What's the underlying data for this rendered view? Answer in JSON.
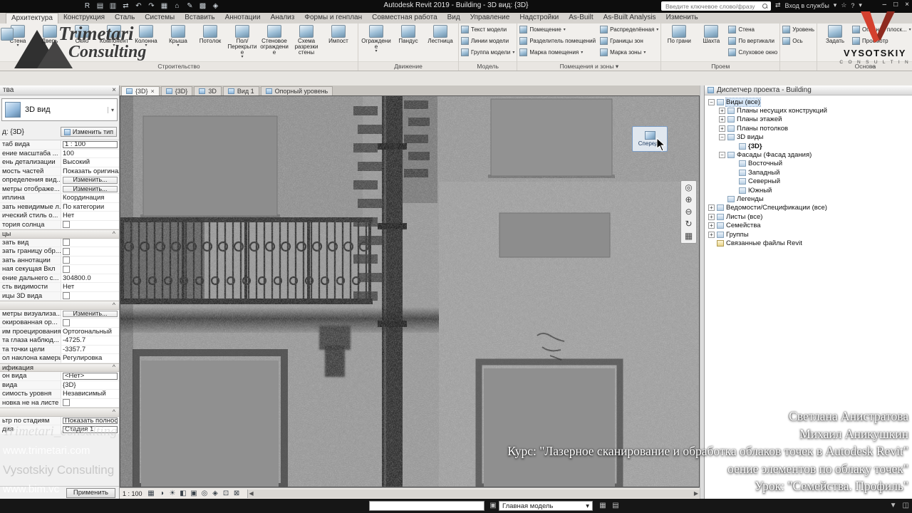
{
  "titlebar": {
    "title": "Autodesk Revit 2019 - Building - 3D вид: {3D}",
    "search_placeholder": "Введите ключевое слово/фразу",
    "qat_icons": [
      "R",
      "▤",
      "▥",
      "⇄",
      "↶",
      "↷",
      "▦",
      "⌂",
      "✎",
      "▩",
      "◈"
    ],
    "exchange_icon": "⇄",
    "signin_label": "Вход в службы",
    "signin_arrow": "▾",
    "star_icon": "☆",
    "help_icon": "?",
    "help_arrow": "▾",
    "window_buttons": [
      "–",
      "□",
      "×"
    ]
  },
  "ribbon": {
    "tabs": [
      {
        "label": "Архитектура",
        "cls": "active"
      },
      {
        "label": "Конструкция",
        "cls": ""
      },
      {
        "label": "Сталь",
        "cls": ""
      },
      {
        "label": "Системы",
        "cls": ""
      },
      {
        "label": "Вставить",
        "cls": ""
      },
      {
        "label": "Аннотации",
        "cls": ""
      },
      {
        "label": "Анализ",
        "cls": ""
      },
      {
        "label": "Формы и генплан",
        "cls": ""
      },
      {
        "label": "Совместная работа",
        "cls": ""
      },
      {
        "label": "Вид",
        "cls": ""
      },
      {
        "label": "Управление",
        "cls": ""
      },
      {
        "label": "Надстройки",
        "cls": ""
      },
      {
        "label": "As-Built",
        "cls": ""
      },
      {
        "label": "As-Built Analysis",
        "cls": ""
      },
      {
        "label": "Изменить",
        "cls": ""
      }
    ],
    "groups": [
      {
        "label": "Строительство",
        "big": [
          {
            "label": "Стена",
            "arrow": "▾"
          },
          {
            "label": "Дверь",
            "arrow": ""
          },
          {
            "label": "Окно",
            "arrow": ""
          },
          {
            "label": "Компонент",
            "arrow": "▾"
          },
          {
            "label": "Колонна",
            "arrow": "▾"
          },
          {
            "label": "Крыша",
            "arrow": "▾"
          },
          {
            "label": "Потолок",
            "arrow": ""
          },
          {
            "label": "Пол/Перекрытие",
            "arrow": "▾"
          },
          {
            "label": "Стеновое ограждение",
            "arrow": ""
          },
          {
            "label": "Схема разрезки стены",
            "arrow": ""
          },
          {
            "label": "Импост",
            "arrow": ""
          }
        ],
        "small": []
      },
      {
        "label": "Движение",
        "big": [
          {
            "label": "Ограждение",
            "arrow": "▾"
          },
          {
            "label": "Пандус",
            "arrow": ""
          },
          {
            "label": "Лестница",
            "arrow": ""
          }
        ],
        "small": []
      },
      {
        "label": "Модель",
        "big": [],
        "small": [
          {
            "label": "Текст модели",
            "arrow": ""
          },
          {
            "label": "Линии модели",
            "arrow": ""
          },
          {
            "label": "Группа модели",
            "arrow": "▾"
          }
        ]
      },
      {
        "label": "Помещения и зоны ▾",
        "big": [],
        "small": [
          {
            "label": "Помещение",
            "arrow": "▾"
          },
          {
            "label": "Распределённая",
            "arrow": "▾"
          },
          {
            "label": "Разделитель помещений",
            "arrow": ""
          },
          {
            "label": "Границы зон",
            "arrow": ""
          },
          {
            "label": "Марка помещения",
            "arrow": "▾"
          },
          {
            "label": "Марка зоны",
            "arrow": "▾"
          }
        ]
      },
      {
        "label": "Проем",
        "big": [
          {
            "label": "По грани",
            "arrow": ""
          },
          {
            "label": "Шахта",
            "arrow": ""
          }
        ],
        "small": [
          {
            "label": "Стена",
            "arrow": ""
          },
          {
            "label": "По вертикали",
            "arrow": ""
          },
          {
            "label": "Слуховое окно",
            "arrow": ""
          }
        ]
      },
      {
        "label": "",
        "big": [],
        "small": [
          {
            "label": "Уровень",
            "arrow": ""
          },
          {
            "label": "Ось",
            "arrow": ""
          }
        ]
      },
      {
        "label": "Основа",
        "big": [
          {
            "label": "Задать",
            "arrow": ""
          }
        ],
        "small": [
          {
            "label": "Опорная плоск...",
            "arrow": "▾"
          },
          {
            "label": "Просмотр",
            "arrow": ""
          }
        ]
      }
    ]
  },
  "properties": {
    "header": "тва",
    "close": "×",
    "selector_label": "3D вид",
    "selector_arrow": "▾",
    "type_label": "д: {3D}",
    "edit_type": "Изменить тип",
    "apply": "Применить",
    "rows": [
      {
        "label": "таб вида",
        "value": "1 : 100",
        "type": "box"
      },
      {
        "label": "ение масштаба ...",
        "value": "100",
        "type": "text"
      },
      {
        "label": "ень детализации",
        "value": "Высокий",
        "type": "text"
      },
      {
        "label": "мость частей",
        "value": "Показать оригинал",
        "type": "text"
      },
      {
        "label": "определения вид...",
        "value": "Изменить...",
        "type": "button"
      },
      {
        "label": "метры отображе...",
        "value": "Изменить...",
        "type": "button"
      },
      {
        "label": "иплина",
        "value": "Координация",
        "type": "text"
      },
      {
        "label": "зать невидимые л...",
        "value": "По категории",
        "type": "text"
      },
      {
        "label": "ический стиль о...",
        "value": "Нет",
        "type": "text"
      },
      {
        "label": "тория солнца",
        "value": "",
        "type": "checkbox"
      },
      {
        "label": "цы",
        "value": "",
        "type": "section"
      },
      {
        "label": "зать вид",
        "value": "",
        "type": "checkbox"
      },
      {
        "label": "зать границу обр...",
        "value": "",
        "type": "checkbox"
      },
      {
        "label": "зать аннотации",
        "value": "",
        "type": "checkbox"
      },
      {
        "label": "ная секущая Вкл",
        "value": "",
        "type": "checkbox"
      },
      {
        "label": "ение дальнего с...",
        "value": "304800.0",
        "type": "text"
      },
      {
        "label": "сть видимости",
        "value": "Нет",
        "type": "text"
      },
      {
        "label": "ицы 3D вида",
        "value": "",
        "type": "checkbox"
      },
      {
        "label": "",
        "value": "",
        "type": "section"
      },
      {
        "label": "метры визуализа...",
        "value": "Изменить...",
        "type": "button"
      },
      {
        "label": "окированная ор...",
        "value": "",
        "type": "checkbox"
      },
      {
        "label": "им проецирования",
        "value": "Ортогональный",
        "type": "text"
      },
      {
        "label": "та глаза наблюд...",
        "value": "-4725.7",
        "type": "text"
      },
      {
        "label": "та точки цели",
        "value": "-3357.7",
        "type": "text"
      },
      {
        "label": "ол наклона камеры",
        "value": "Регулировка",
        "type": "text"
      },
      {
        "label": "ификация",
        "value": "",
        "type": "section"
      },
      {
        "label": "он вида",
        "value": "<Нет>",
        "type": "box"
      },
      {
        "label": "вида",
        "value": "{3D}",
        "type": "text"
      },
      {
        "label": "симость уровня",
        "value": "Независимый",
        "type": "text"
      },
      {
        "label": "новка не на листе",
        "value": "",
        "type": "checkbox"
      },
      {
        "label": "",
        "value": "",
        "type": "section"
      },
      {
        "label": "ьтр по стадиям",
        "value": "Показать полност...",
        "type": "box"
      },
      {
        "label": "дия",
        "value": "Стадия 1",
        "type": "box"
      }
    ]
  },
  "view_tabs": [
    {
      "label": "{3D}",
      "cls": "active",
      "close": "×"
    },
    {
      "label": "{3D}",
      "cls": "",
      "close": ""
    },
    {
      "label": "3D",
      "cls": "",
      "close": ""
    },
    {
      "label": "Вид 1",
      "cls": "",
      "close": ""
    },
    {
      "label": "Опорный уровень",
      "cls": "",
      "close": ""
    }
  ],
  "viewport": {
    "viewcube_label": "Спереди",
    "nav_icons": [
      "◎",
      "⊕",
      "⊖",
      "↻",
      "▦"
    ],
    "controls": {
      "scale": "1 : 100",
      "icons": [
        "▦",
        "◑",
        "☀",
        "◧",
        "▣",
        "◎",
        "◈",
        "⊡",
        "⊠"
      ],
      "scroll_left": "◀",
      "scroll_right": "▶"
    }
  },
  "browser": {
    "title": "Диспетчер проекта - Building",
    "items": [
      {
        "glyph": "−",
        "label": "Виды (все)",
        "cls": "d0 sel"
      },
      {
        "glyph": "+",
        "label": "Планы несущих конструкций",
        "cls": "d1"
      },
      {
        "glyph": "+",
        "label": "Планы этажей",
        "cls": "d1"
      },
      {
        "glyph": "+",
        "label": "Планы потолков",
        "cls": "d1"
      },
      {
        "glyph": "−",
        "label": "3D виды",
        "cls": "d1"
      },
      {
        "glyph": "",
        "label": "{3D}",
        "cls": "d2 cur"
      },
      {
        "glyph": "−",
        "label": "Фасады (Фасад здания)",
        "cls": "d1"
      },
      {
        "glyph": "",
        "label": "Восточный",
        "cls": "d2"
      },
      {
        "glyph": "",
        "label": "Западный",
        "cls": "d2"
      },
      {
        "glyph": "",
        "label": "Северный",
        "cls": "d2"
      },
      {
        "glyph": "",
        "label": "Южный",
        "cls": "d2"
      },
      {
        "glyph": "",
        "label": "Легенды",
        "cls": "d1"
      },
      {
        "glyph": "+",
        "label": "Ведомости/Спецификации (все)",
        "cls": "d0"
      },
      {
        "glyph": "+",
        "label": "Листы (все)",
        "cls": "d0"
      },
      {
        "glyph": "+",
        "label": "Семейства",
        "cls": "d0"
      },
      {
        "glyph": "+",
        "label": "Группы",
        "cls": "d0"
      },
      {
        "glyph": "",
        "label": "Связанные файлы Revit",
        "cls": "d0 link"
      }
    ]
  },
  "statusbar": {
    "design_option": "Главная модель",
    "dropdown_arrow": "▾",
    "mid_icon": "▣",
    "icons": [
      "▦",
      "▤"
    ],
    "right_icons": [
      "▼",
      "◫"
    ]
  },
  "watermarks": {
    "left": [
      {
        "text": "Trimetari_consulting",
        "cls": "wm-script"
      },
      {
        "text": "www.trimetari.com",
        "cls": "wm-white"
      },
      {
        "text": "Vysotskiy Consulting",
        "cls": "wm-gray"
      },
      {
        "text": "www.bim.vc",
        "cls": "wm-white"
      }
    ],
    "credits": [
      "Светлана Анистратова",
      "Михаил Аникушкин",
      "Курс: \"Лазерное сканирование и обработка облаков точек в Autodesk Revit\"",
      "оение элементов по облаку точек\"",
      "Урок: \"Семейства. Профиль\""
    ],
    "trimetari_logo": {
      "line1": "Trimetari",
      "line2": "Consulting"
    },
    "vysotskiy_logo": {
      "line1": "VYSOTSKIY",
      "line2": "C O N S U L T I N G"
    }
  }
}
